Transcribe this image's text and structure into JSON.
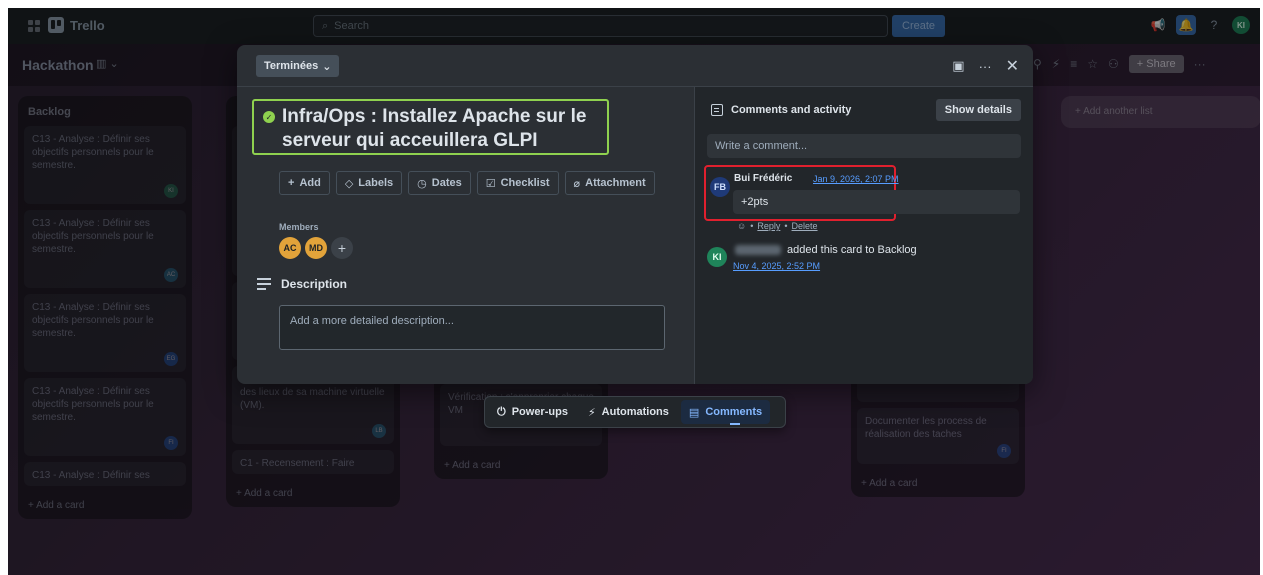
{
  "topbar": {
    "app_name": "Trello",
    "search_placeholder": "Search",
    "create_label": "Create",
    "user_initials": "KI"
  },
  "board": {
    "title": "Hackathon",
    "share_label": "Share",
    "add_list_label": "+ Add another list"
  },
  "lists": [
    {
      "title": "Backlog",
      "cards": [
        {
          "text": "C13 - Analyse : Définir ses objectifs personnels pour le semestre.",
          "avatar": "KI"
        },
        {
          "text": "C13 - Analyse : Définir ses objectifs personnels pour le semestre.",
          "avatar": "AC"
        },
        {
          "text": "C13 - Analyse : Définir ses objectifs personnels pour le semestre.",
          "avatar": "EG"
        },
        {
          "text": "C13 - Analyse : Définir ses objectifs personnels pour le semestre.",
          "avatar": "FI"
        },
        {
          "text": "C13 - Analyse : Définir ses"
        }
      ],
      "add_card": "+ Add a card"
    },
    {
      "title": "",
      "cards": [
        {
          "text": "C1 - Recensement : Faire l'état des lieux de sa machine virtuelle (VM).",
          "avatar": "LB"
        },
        {
          "text": "C1 - Recensement : Faire"
        }
      ],
      "add_card": "+ Add a card"
    },
    {
      "title": "",
      "cards": [
        {
          "text": "Vérification : s'approprier chaque VM",
          "count": "1"
        }
      ],
      "add_card": "+ Add a card"
    },
    {
      "title": "",
      "cards": [
        {
          "text": "Documenter les process de réalisation des taches",
          "avatar": "FI"
        }
      ],
      "add_card": "+ Add a card"
    }
  ],
  "modal": {
    "status_label": "Terminées",
    "card_title": "Infra/Ops : Installez Apache sur le serveur qui acceuillera GLPI",
    "actions": [
      "Add",
      "Labels",
      "Dates",
      "Checklist",
      "Attachment"
    ],
    "members_label": "Members",
    "members": [
      "AC",
      "MD"
    ],
    "description_label": "Description",
    "description_placeholder": "Add a more detailed description...",
    "activity": {
      "heading": "Comments and activity",
      "show_details": "Show details",
      "comment_placeholder": "Write a comment...",
      "comment": {
        "avatar": "FB",
        "author": "Bui Frédéric",
        "time": "Jan 9, 2026, 2:07 PM",
        "text": "+2pts",
        "reply": "Reply",
        "delete": "Delete"
      },
      "event": {
        "avatar": "KI",
        "text": "added this card to Backlog",
        "time": "Nov 4, 2025, 2:52 PM"
      }
    }
  },
  "floatbar": {
    "powerups": "Power-ups",
    "automations": "Automations",
    "comments": "Comments"
  },
  "colors": {
    "title_highlight": "#8fd14f",
    "comment_highlight": "#e1202e",
    "link": "#579dff"
  }
}
